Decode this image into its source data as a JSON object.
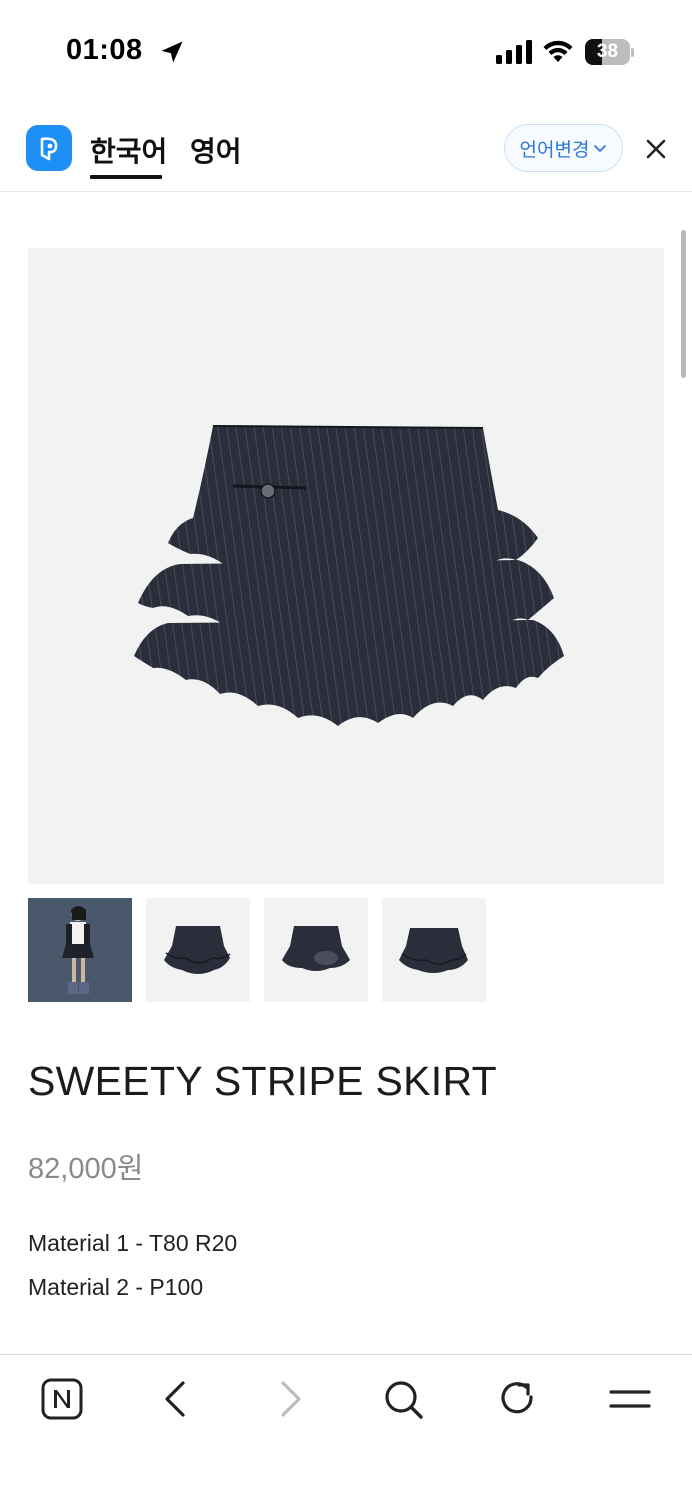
{
  "status_bar": {
    "time": "01:08",
    "battery": "38"
  },
  "translate_bar": {
    "tabs": [
      {
        "label": "한국어",
        "active": true
      },
      {
        "label": "영어",
        "active": false
      }
    ],
    "change_language_label": "언어변경",
    "accent_color": "#2b78d8",
    "logo_color": "#1e90f5"
  },
  "product": {
    "title": "SWEETY STRIPE SKIRT",
    "price": "82,000원",
    "materials": [
      "Material 1 - T80 R20",
      "Material 2 - P100"
    ],
    "thumbnail_count": 4
  },
  "toolbar": {
    "icons": [
      "naver-n-icon",
      "back-arrow-icon",
      "forward-arrow-icon",
      "search-icon",
      "refresh-icon",
      "menu-icon"
    ]
  }
}
